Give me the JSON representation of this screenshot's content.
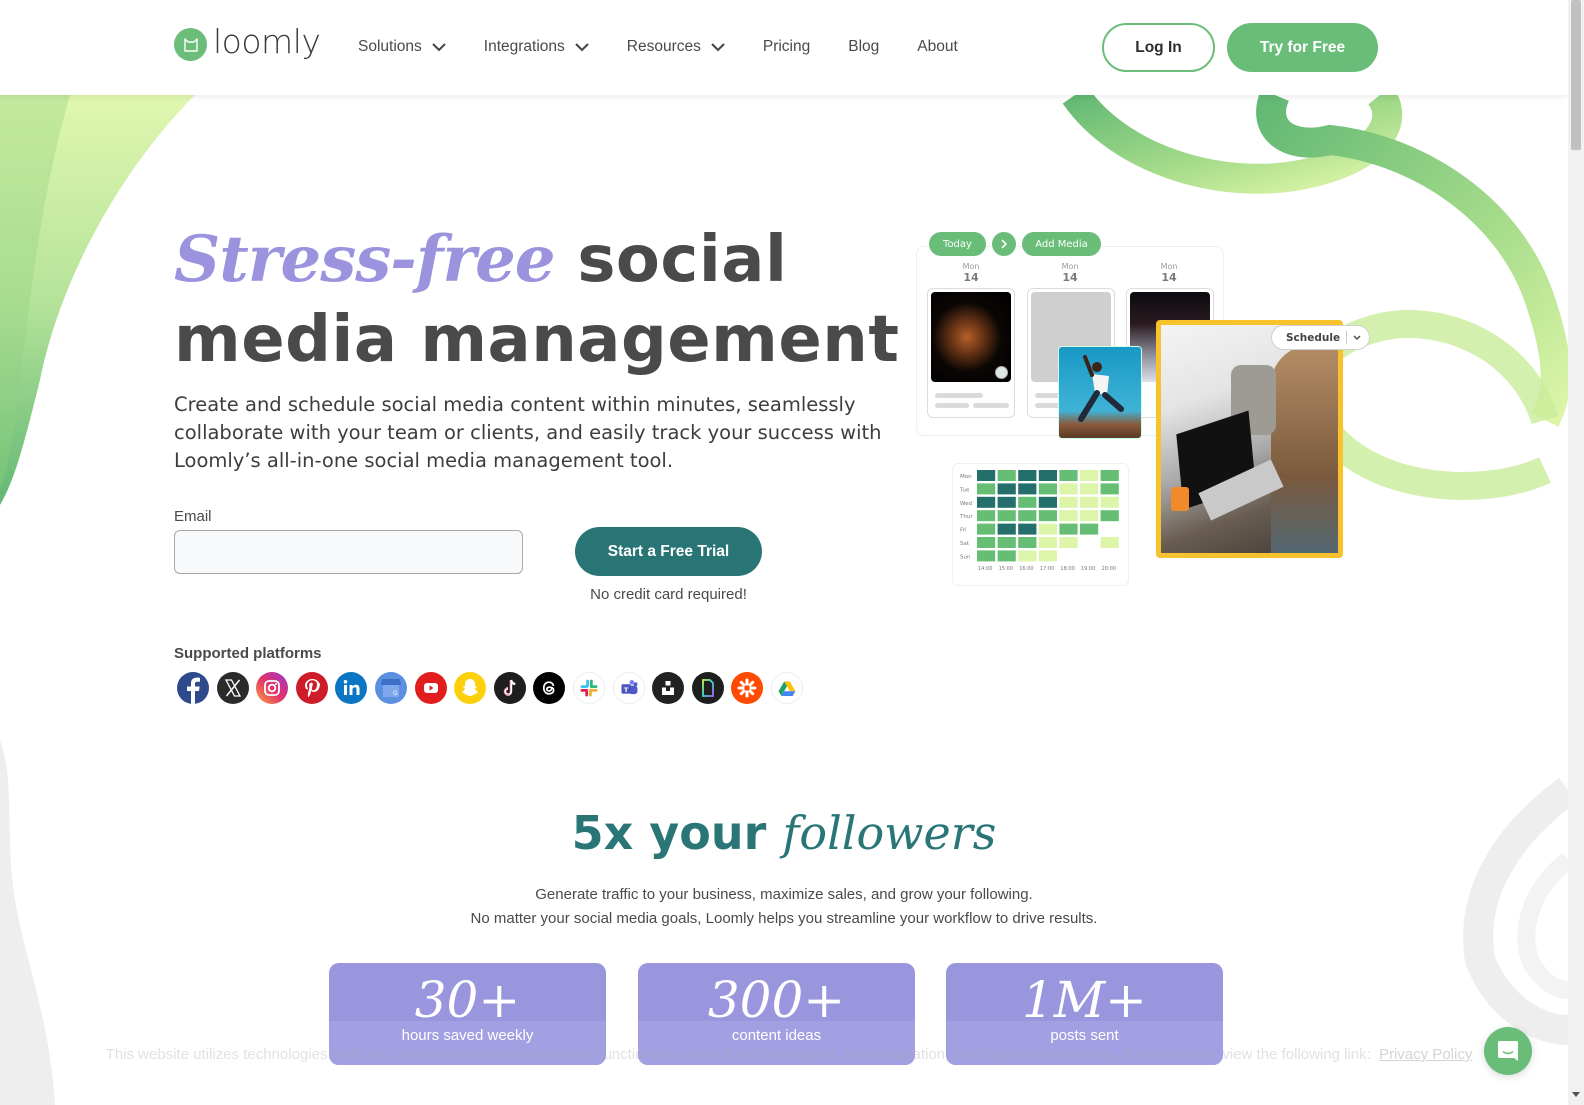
{
  "header": {
    "logo_text": "loomly",
    "nav": [
      {
        "label": "Solutions",
        "has_dropdown": true
      },
      {
        "label": "Integrations",
        "has_dropdown": true
      },
      {
        "label": "Resources",
        "has_dropdown": true
      },
      {
        "label": "Pricing",
        "has_dropdown": false
      },
      {
        "label": "Blog",
        "has_dropdown": false
      },
      {
        "label": "About",
        "has_dropdown": false
      }
    ],
    "login_label": "Log In",
    "try_label": "Try for Free"
  },
  "hero": {
    "title_accent": "Stress-free",
    "title_rest_line1": " social",
    "title_line2": "media management",
    "description": "Create and schedule social media content within minutes, seamlessly collaborate with your team or clients, and easily track your success with Loomly’s all-in-one social media management tool.",
    "email_label": "Email",
    "email_value": "",
    "email_placeholder": "",
    "cta_label": "Start a Free Trial",
    "cta_note": "No credit card required!",
    "platforms_label": "Supported platforms",
    "platforms": [
      {
        "name": "Facebook",
        "icon": "facebook-icon",
        "color": "#2d4a8a"
      },
      {
        "name": "X",
        "icon": "x-icon",
        "color": "#2b2b2b"
      },
      {
        "name": "Instagram",
        "icon": "instagram-icon",
        "color": "#d6457f"
      },
      {
        "name": "Pinterest",
        "icon": "pinterest-icon",
        "color": "#cf1c2b"
      },
      {
        "name": "LinkedIn",
        "icon": "linkedin-icon",
        "color": "#0a75c2"
      },
      {
        "name": "Google Business Profile",
        "icon": "google-business-icon",
        "color": "#5b8fe0"
      },
      {
        "name": "YouTube",
        "icon": "youtube-icon",
        "color": "#e21d1d"
      },
      {
        "name": "Snapchat",
        "icon": "snapchat-icon",
        "color": "#fcd00a"
      },
      {
        "name": "TikTok",
        "icon": "tiktok-icon",
        "color": "#1e1e1e"
      },
      {
        "name": "Threads",
        "icon": "threads-icon",
        "color": "#000000"
      },
      {
        "name": "Slack",
        "icon": "slack-icon",
        "color": "#ffffff"
      },
      {
        "name": "Microsoft Teams",
        "icon": "teams-icon",
        "color": "#ffffff"
      },
      {
        "name": "Unsplash",
        "icon": "unsplash-icon",
        "color": "#222222"
      },
      {
        "name": "Canva",
        "icon": "canva-icon",
        "color": "#1e1e1e"
      },
      {
        "name": "Zapier",
        "icon": "zapier-icon",
        "color": "#ff4a00"
      },
      {
        "name": "Google Drive",
        "icon": "google-drive-icon",
        "color": "#ffffff"
      }
    ]
  },
  "mockup": {
    "today_label": "Today",
    "add_media_label": "Add Media",
    "schedule_label": "Schedule",
    "days": [
      {
        "name": "Mon",
        "num": "14"
      },
      {
        "name": "Mon",
        "num": "14"
      },
      {
        "name": "Mon",
        "num": "14"
      }
    ],
    "heatmap": {
      "rows": [
        "Mon",
        "Tue",
        "Wed",
        "Thur",
        "Fri",
        "Sat",
        "Sun"
      ],
      "cols": [
        "14:00",
        "15:00",
        "16:00",
        "17:00",
        "18:00",
        "19:00",
        "20:00"
      ],
      "levels": [
        [
          3,
          2,
          3,
          3,
          2,
          1,
          2
        ],
        [
          2,
          3,
          3,
          2,
          1,
          1,
          2
        ],
        [
          3,
          3,
          2,
          3,
          1,
          1,
          1
        ],
        [
          2,
          2,
          2,
          2,
          1,
          1,
          2
        ],
        [
          2,
          3,
          3,
          1,
          2,
          2,
          0
        ],
        [
          2,
          2,
          2,
          1,
          1,
          0,
          1
        ],
        [
          2,
          2,
          1,
          1,
          0,
          0,
          0
        ]
      ],
      "colors": [
        "transparent",
        "#dcf5a8",
        "#66bd74",
        "#246f6c"
      ]
    }
  },
  "section2": {
    "title_main": "5x your ",
    "title_accent": "followers",
    "desc_line1": "Generate traffic to your business, maximize sales, and grow your following.",
    "desc_line2": "No matter your social media goals, Loomly helps you streamline your workflow to drive results.",
    "stats": [
      {
        "value": "30+",
        "label": "hours saved weekly"
      },
      {
        "value": "300+",
        "label": "content ideas"
      },
      {
        "value": "1M+",
        "label": "posts sent"
      }
    ]
  },
  "cookie": {
    "text": "This website utilizes technologies such as cookies to enable essential site functionality, as well as for analytics, personalization, and targeted advertising. To learn more, view the following link:",
    "link_label": "Privacy Policy"
  },
  "colors": {
    "brand_green": "#69bd79",
    "teal": "#297575",
    "lavender": "#9b93de",
    "stat_card": "#9a96de"
  }
}
